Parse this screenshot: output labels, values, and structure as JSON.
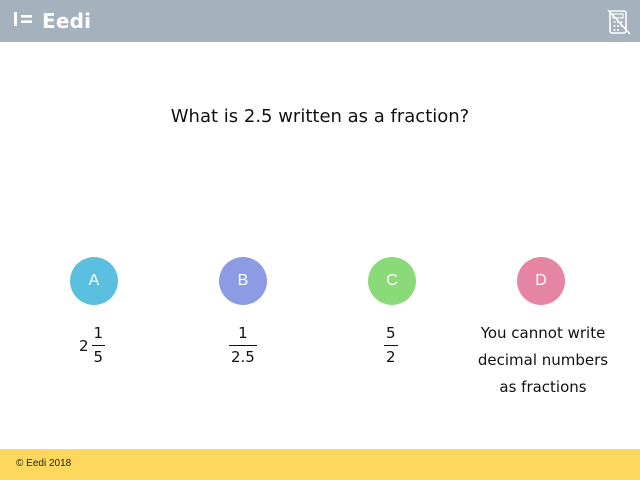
{
  "header": {
    "brand": "Eedi",
    "logo_icon": "eedi-logo-icon",
    "calculator_icon": "calculator-not-allowed-icon",
    "background_color": "#a5b1bc"
  },
  "question": {
    "text": "What is 2.5 written as a fraction?"
  },
  "options": [
    {
      "letter": "A",
      "color": "#5bbfdf",
      "whole": "2",
      "numerator": "1",
      "denominator": "5"
    },
    {
      "letter": "B",
      "color": "#8c9be3",
      "numerator": "1",
      "denominator": "2.5"
    },
    {
      "letter": "C",
      "color": "#8ada7a",
      "numerator": "5",
      "denominator": "2"
    },
    {
      "letter": "D",
      "color": "#e585a3",
      "text_lines": [
        "You cannot write",
        "decimal numbers",
        "as fractions"
      ]
    }
  ],
  "footer": {
    "copyright": "© Eedi 2018",
    "background_color": "#fdd85c"
  }
}
